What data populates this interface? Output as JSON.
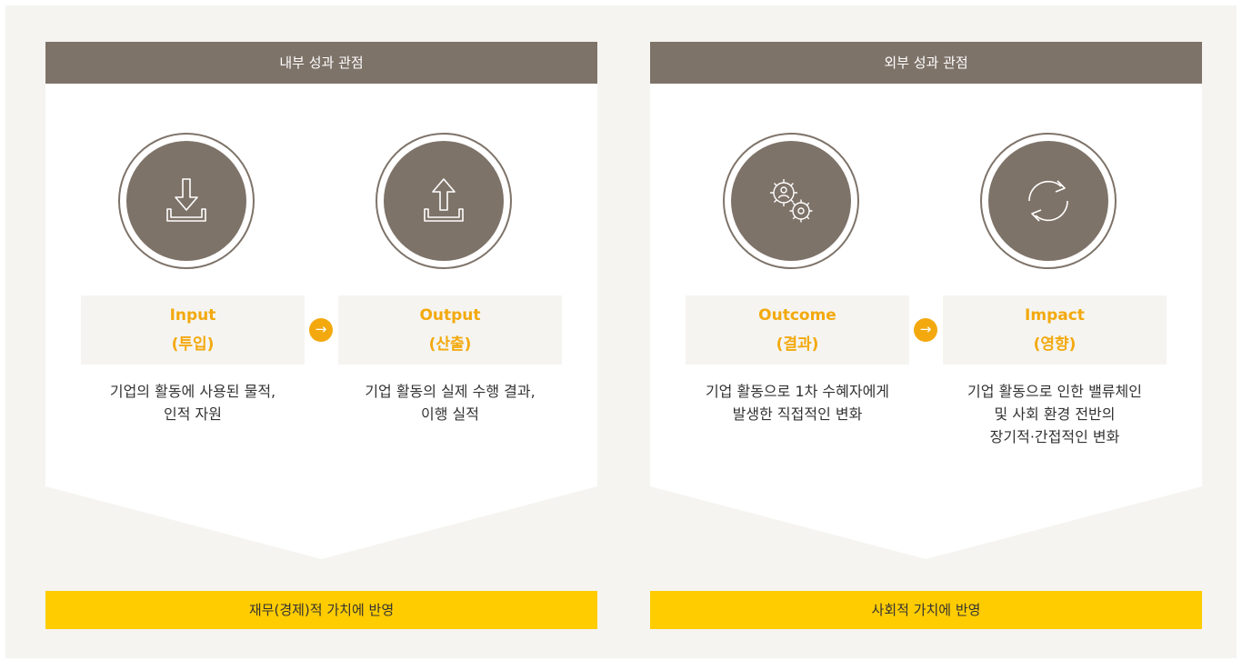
{
  "colors": {
    "panel_header": "#7e7369",
    "accent_orange": "#f3a90e",
    "result_yellow": "#ffcc00",
    "background": "#f5f4f0"
  },
  "internal": {
    "header": "내부 성과 관점",
    "items": [
      {
        "icon": "download-tray-icon",
        "name": "Input",
        "sub": "(투입)",
        "desc": [
          "기업의 활동에 사용된 물적,",
          "인적 자원"
        ]
      },
      {
        "icon": "upload-tray-icon",
        "name": "Output",
        "sub": "(산출)",
        "desc": [
          "기업 활동의 실제 수행 결과,",
          "이행 실적"
        ]
      }
    ],
    "arrow": "→",
    "result": "재무(경제)적 가치에 반영"
  },
  "external": {
    "header": "외부 성과 관점",
    "items": [
      {
        "icon": "gears-person-icon",
        "name": "Outcome",
        "sub": "(결과)",
        "desc": [
          "기업 활동으로 1차 수혜자에게",
          "발생한 직접적인 변화"
        ]
      },
      {
        "icon": "refresh-cycle-icon",
        "name": "Impact",
        "sub": "(영향)",
        "desc": [
          "기업 활동으로 인한 밸류체인",
          "및 사회 환경 전반의",
          "장기적·간접적인 변화"
        ]
      }
    ],
    "arrow": "→",
    "result": "사회적 가치에 반영"
  }
}
